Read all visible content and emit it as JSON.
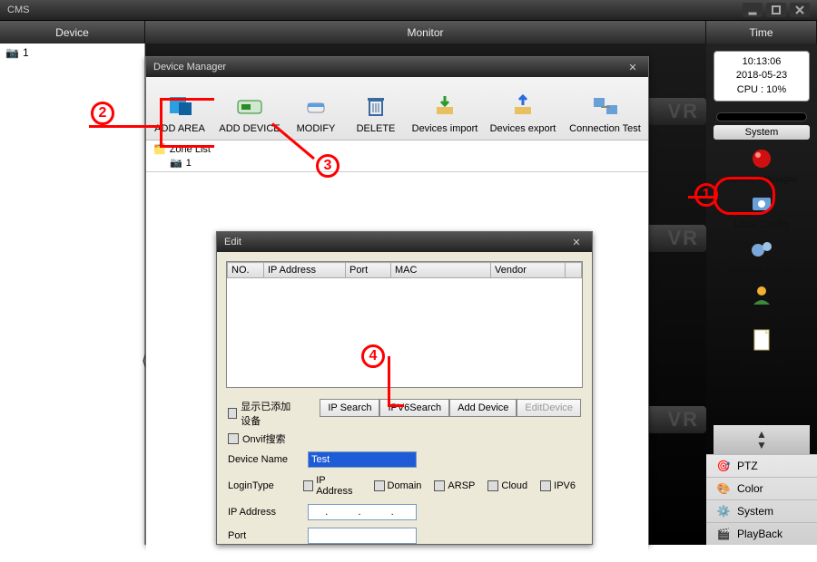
{
  "app_title": "CMS",
  "tabs": {
    "device": "Device",
    "monitor": "Monitor",
    "time": "Time"
  },
  "left_tree": {
    "root": "1"
  },
  "clock": {
    "time": "10:13:06",
    "date": "2018-05-23",
    "cpu": "CPU : 10%"
  },
  "system_label": "System",
  "system_items": [
    {
      "label": "Device Manager"
    },
    {
      "label": "Local Config"
    },
    {
      "label": "Remote Config"
    },
    {
      "label": "Account"
    },
    {
      "label": "Local Log"
    }
  ],
  "bottom_items": [
    {
      "label": "PTZ"
    },
    {
      "label": "Color"
    },
    {
      "label": "System"
    },
    {
      "label": "PlayBack"
    }
  ],
  "devmgr": {
    "title": "Device Manager",
    "toolbar": [
      "ADD AREA",
      "ADD DEVICE",
      "MODIFY",
      "DELETE",
      "Devices import",
      "Devices export",
      "Connection Test"
    ],
    "zone_header": "Zone List",
    "zone_child": "1"
  },
  "edit": {
    "title": "Edit",
    "cols": [
      "NO.",
      "IP Address",
      "Port",
      "MAC",
      "Vendor"
    ],
    "chk1": "显示已添加设备",
    "chk2": "Onvif搜索",
    "btns": [
      "IP Search",
      "IPV6Search",
      "Add Device",
      "EditDevice"
    ],
    "device_name_label": "Device Name",
    "device_name_value": "Test",
    "login_type_label": "LoginType",
    "login_types": [
      "IP Address",
      "Domain",
      "ARSP",
      "Cloud",
      "IPV6"
    ],
    "ip_label": "IP Address",
    "ip_value": ".   .   .",
    "port_label": "Port"
  },
  "annotations": {
    "a1": "1",
    "a2": "2",
    "a3": "3",
    "a4": "4"
  },
  "vr": "VR"
}
